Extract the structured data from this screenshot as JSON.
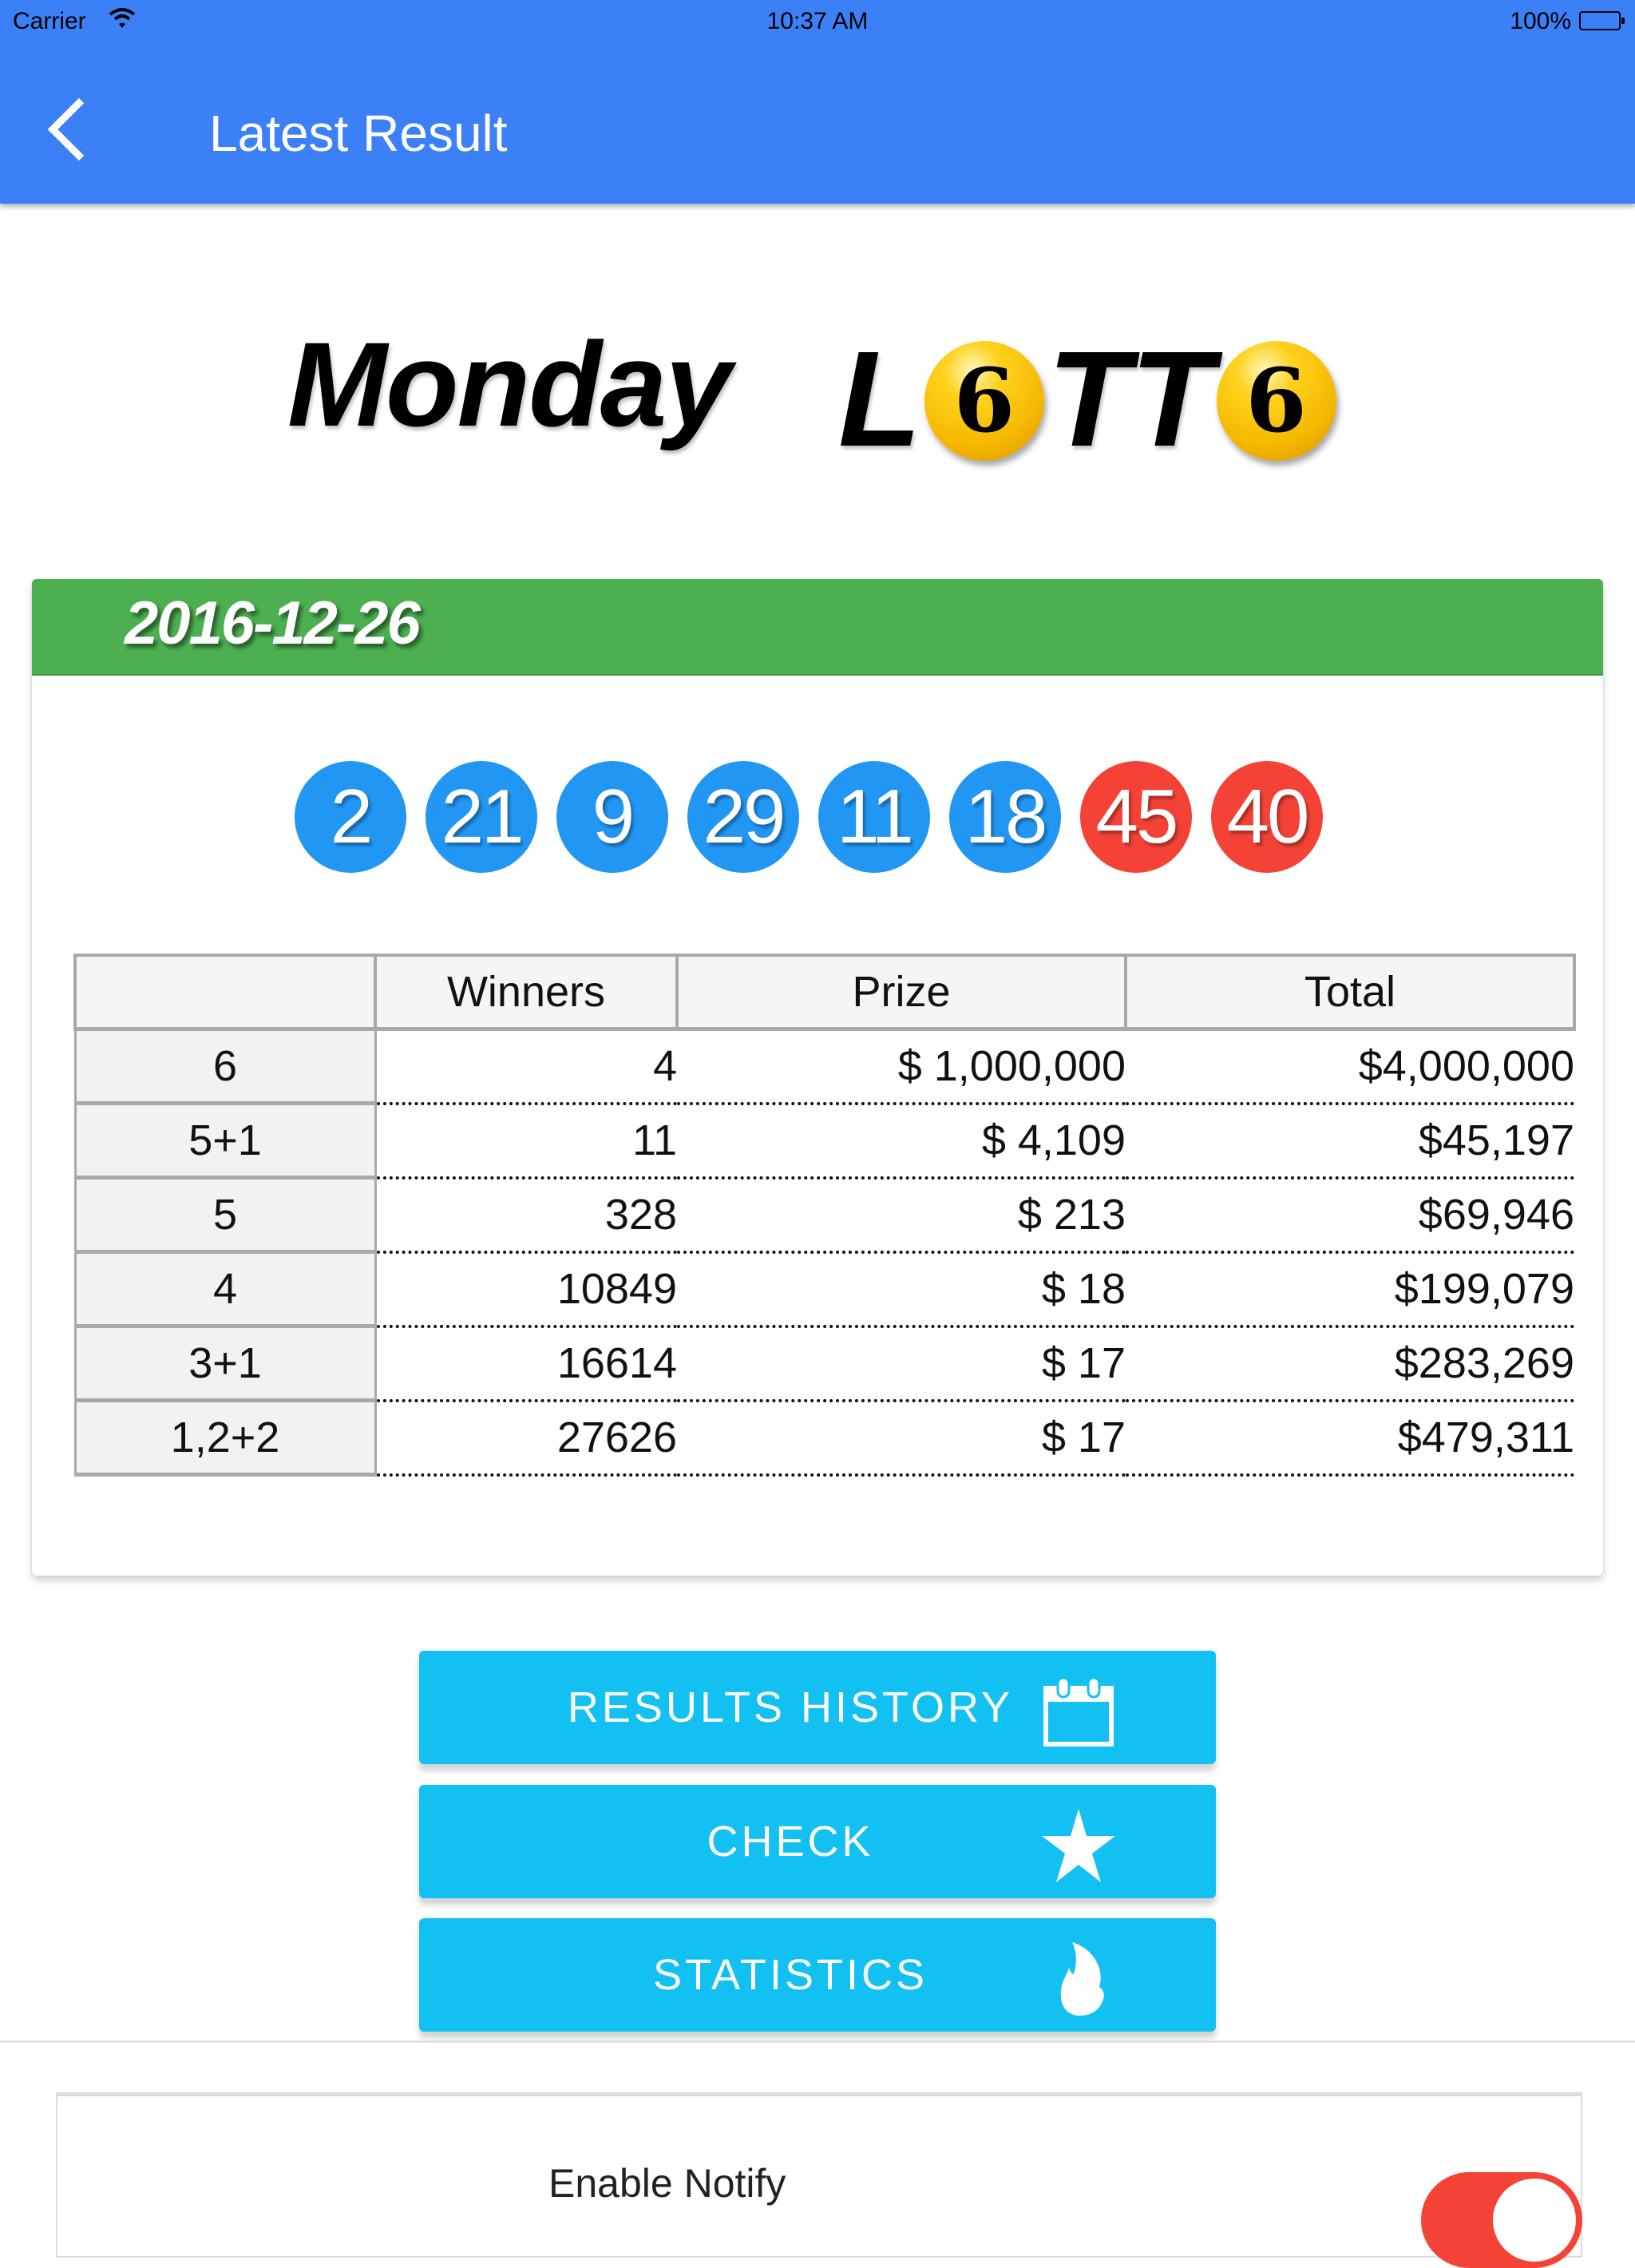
{
  "status_bar": {
    "carrier": "Carrier",
    "time": "10:37 AM",
    "battery": "100%"
  },
  "nav": {
    "back_icon": "chevron-left-icon",
    "title": "Latest Result"
  },
  "logo": {
    "day": "Monday",
    "letters": [
      "L",
      "6",
      "T",
      "T",
      "6"
    ],
    "ball_color": "#f5b800"
  },
  "result": {
    "date": "2016-12-26",
    "header_color": "#4caf50",
    "main_numbers": [
      "2",
      "21",
      "9",
      "29",
      "11",
      "18"
    ],
    "bonus_numbers": [
      "45",
      "40"
    ],
    "main_color": "#2196f3",
    "bonus_color": "#f44336"
  },
  "table": {
    "headers": [
      "",
      "Winners",
      "Prize",
      "Total"
    ],
    "rows": [
      {
        "division": "6",
        "winners": "4",
        "prize": "$ 1,000,000",
        "total": "$4,000,000"
      },
      {
        "division": "5+1",
        "winners": "11",
        "prize": "$ 4,109",
        "total": "$45,197"
      },
      {
        "division": "5",
        "winners": "328",
        "prize": "$ 213",
        "total": "$69,946"
      },
      {
        "division": "4",
        "winners": "10849",
        "prize": "$ 18",
        "total": "$199,079"
      },
      {
        "division": "3+1",
        "winners": "16614",
        "prize": "$ 17",
        "total": "$283,269"
      },
      {
        "division": "1,2+2",
        "winners": "27626",
        "prize": "$ 17",
        "total": "$479,311"
      }
    ]
  },
  "buttons": [
    {
      "label": "RESULTS HISTORY",
      "icon": "calendar-icon"
    },
    {
      "label": "CHECK",
      "icon": "star-icon"
    },
    {
      "label": "STATISTICS",
      "icon": "flame-icon"
    }
  ],
  "button_color": "#12c0f2",
  "notify": {
    "label": "Enable Notify",
    "enabled": true,
    "toggle_color": "#f44336"
  }
}
